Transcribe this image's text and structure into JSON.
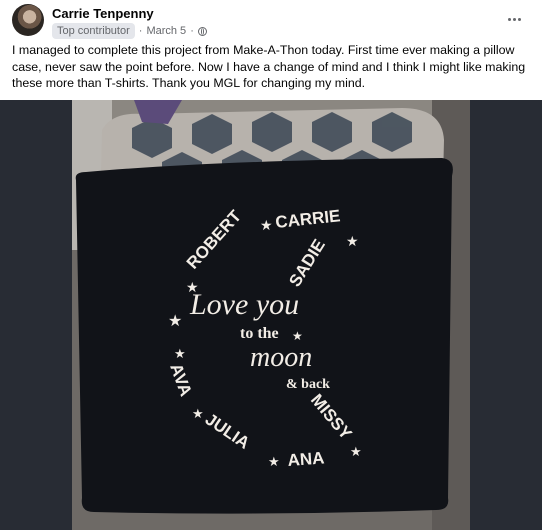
{
  "post": {
    "author": "Carrie Tenpenny",
    "badge": "Top contributor",
    "separator": "·",
    "date": "March 5",
    "dot": "·",
    "privacy_icon": "globe-icon",
    "more_icon": "more-options-icon",
    "text": "I managed to complete this project from Make-A-Thon today. First time ever making a pillow case, never saw the point before. Now I have a change of mind and I think I might like making these more than T-shirts. Thank you MGL for changing my mind."
  },
  "pillow": {
    "names": [
      "ROBERT",
      "CARRIE",
      "SADIE",
      "AVA",
      "JULIA",
      "ANA",
      "MISSY"
    ],
    "line1": "Love you",
    "line2": "to the",
    "line3": "moon",
    "line4": "& back"
  },
  "colors": {
    "pillow": "#111318",
    "cushion": "#6e6a66",
    "text_print": "#f2ede6",
    "photo_bg": "#282c34"
  }
}
